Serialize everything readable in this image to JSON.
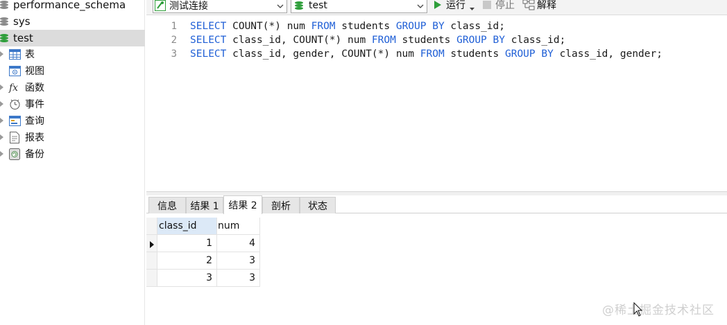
{
  "sidebar": {
    "databases": [
      {
        "name": "performance_schema"
      },
      {
        "name": "sys"
      },
      {
        "name": "test",
        "selected": true
      }
    ],
    "tree_items": [
      {
        "label": "表",
        "icon": "table-icon"
      },
      {
        "label": "视图",
        "icon": "view-icon"
      },
      {
        "label": "函数",
        "icon": "function-icon"
      },
      {
        "label": "事件",
        "icon": "event-icon"
      },
      {
        "label": "查询",
        "icon": "query-icon"
      },
      {
        "label": "报表",
        "icon": "report-icon"
      },
      {
        "label": "备份",
        "icon": "backup-icon"
      }
    ]
  },
  "toolbar": {
    "connection": "测试连接",
    "database": "test",
    "run_label": "运行",
    "stop_label": "停止",
    "explain_label": "解释"
  },
  "editor": {
    "line_numbers": [
      "1",
      "2",
      "3"
    ]
  },
  "result_tabs": [
    {
      "label": "信息"
    },
    {
      "label": "结果 1"
    },
    {
      "label": "结果 2",
      "active": true
    },
    {
      "label": "剖析"
    },
    {
      "label": "状态"
    }
  ],
  "grid": {
    "columns": [
      "class_id",
      "num"
    ],
    "rows": [
      [
        "1",
        "4"
      ],
      [
        "2",
        "3"
      ],
      [
        "3",
        "3"
      ]
    ]
  },
  "watermark": "@稀土掘金技术社区",
  "colors": {
    "keyword": "#1f5fd6",
    "db_icon": "#2e9e3a",
    "run_icon": "#2e9e3a",
    "header_selected": "#dce9f7"
  }
}
